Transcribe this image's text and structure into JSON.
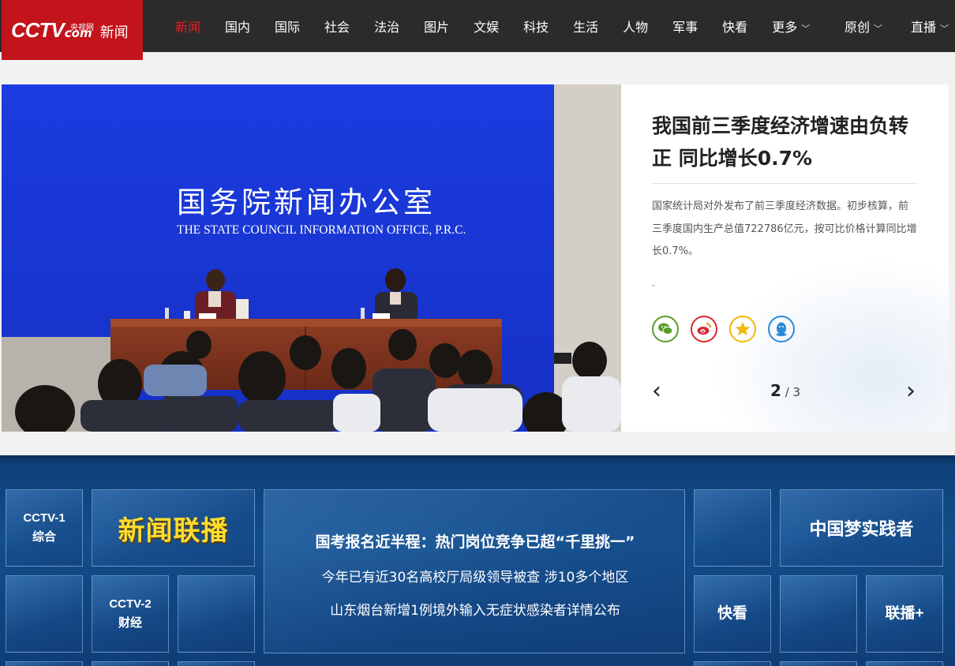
{
  "header": {
    "logo": {
      "brand": "CCTV",
      "domain": "com",
      "small_text": "央视网",
      "section": "新闻"
    },
    "nav": [
      {
        "label": "新闻",
        "active": true
      },
      {
        "label": "国内"
      },
      {
        "label": "国际"
      },
      {
        "label": "社会"
      },
      {
        "label": "法治"
      },
      {
        "label": "图片"
      },
      {
        "label": "文娱"
      },
      {
        "label": "科技"
      },
      {
        "label": "生活"
      },
      {
        "label": "人物"
      },
      {
        "label": "军事"
      },
      {
        "label": "快看"
      },
      {
        "label": "更多",
        "dropdown": true
      }
    ],
    "nav_right": [
      {
        "label": "原创",
        "dropdown": true
      },
      {
        "label": "直播",
        "dropdown": true
      }
    ],
    "colors": {
      "bar": "#2b2b2b",
      "logo_bg": "#c3131b",
      "active": "#e1252b"
    }
  },
  "hero": {
    "image": {
      "banner_cn": "国务院新闻办公室",
      "banner_en": "THE STATE COUNCIL INFORMATION OFFICE, P.R.C."
    },
    "headline": "我国前三季度经济增速由负转正 同比增长0.7%",
    "summary": "国家统计局对外发布了前三季度经济数据。初步核算，前三季度国内生产总值722786亿元，按可比价格计算同比增长0.7%。",
    "share_icons": [
      {
        "name": "wechat-icon",
        "color": "#5a9b2a"
      },
      {
        "name": "weibo-icon",
        "color": "#d9272e"
      },
      {
        "name": "qzone-icon",
        "color": "#f2b705"
      },
      {
        "name": "qq-icon",
        "color": "#2a8ad8"
      }
    ],
    "pager": {
      "current": "2",
      "total": "/ 3",
      "prev": "‹",
      "next": "›"
    }
  },
  "band": {
    "tiles": {
      "cctv1": {
        "line1": "CCTV-1",
        "line2": "综合"
      },
      "cctv2": {
        "line1": "CCTV-2",
        "line2": "财经"
      },
      "xinwen": "新闻联播",
      "dream": "中国梦实践者",
      "kuaikan": "快看",
      "lianbo": "联播+"
    },
    "news": [
      "国考报名近半程：热门岗位竞争已超“千里挑一”",
      "今年已有近30名高校厅局级领导被查 涉10多个地区",
      "山东烟台新增1例境外输入无症状感染者详情公布"
    ]
  }
}
